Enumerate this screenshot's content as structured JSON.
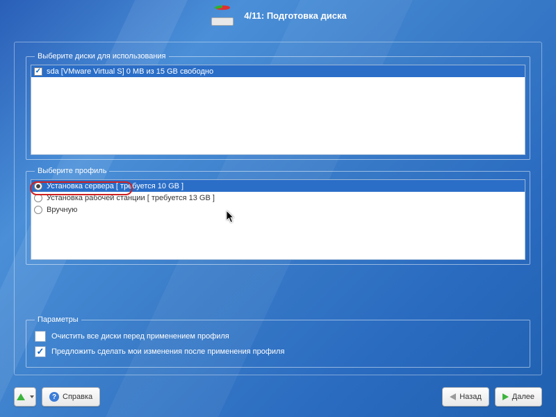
{
  "header": {
    "step": "4/11",
    "title": "Подготовка диска"
  },
  "disks": {
    "legend": "Выберите диски для использования",
    "items": [
      {
        "checked": true,
        "selected": true,
        "label": "sda [VMware Virtual S]   0 MB из 15 GB свободно"
      }
    ]
  },
  "profiles": {
    "legend": "Выберите профиль",
    "items": [
      {
        "checked": true,
        "selected": true,
        "label": "Установка сервера [ требуется 10 GB ]"
      },
      {
        "checked": false,
        "selected": false,
        "label": "Установка рабочей станции [ требуется 13 GB ]"
      },
      {
        "checked": false,
        "selected": false,
        "label": "Вручную"
      }
    ]
  },
  "params": {
    "legend": "Параметры",
    "items": [
      {
        "checked": false,
        "label": "Очистить все диски перед применением профиля"
      },
      {
        "checked": true,
        "label": "Предложить сделать мои изменения после применения профиля"
      }
    ]
  },
  "footer": {
    "help": "Справка",
    "back": "Назад",
    "next": "Далее"
  }
}
